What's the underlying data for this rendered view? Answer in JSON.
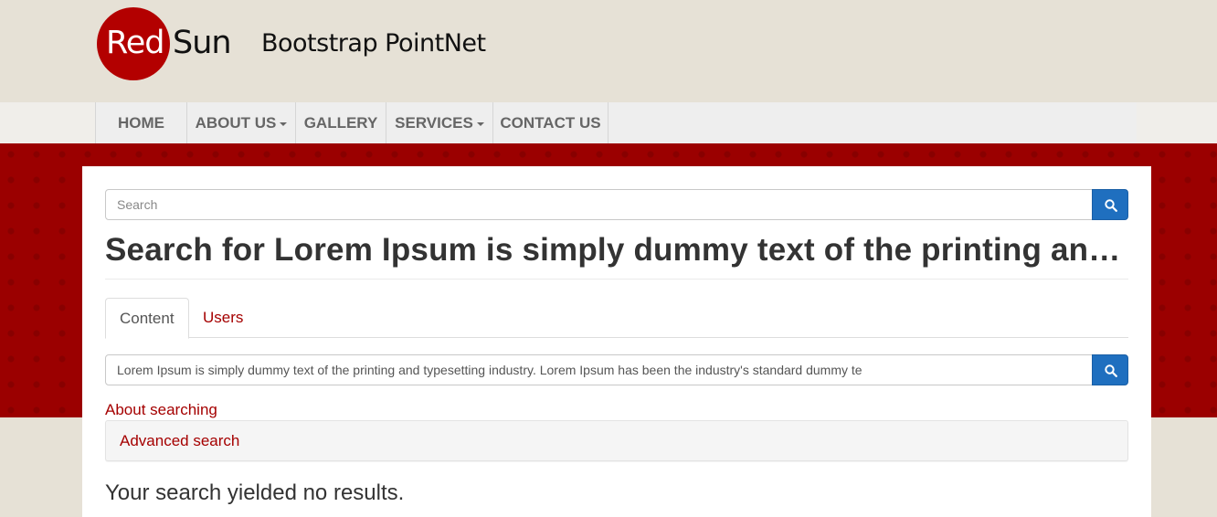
{
  "brand": {
    "logo_red": "Red",
    "logo_sun": "Sun",
    "site_name": "Bootstrap PointNet"
  },
  "nav": {
    "home": "HOME",
    "about": "ABOUT US",
    "gallery": "GALLERY",
    "services": "SERVICES",
    "contact": "CONTACT US"
  },
  "search": {
    "placeholder": "Search",
    "value": ""
  },
  "page": {
    "title": "Search for Lorem Ipsum is simply dummy text of the printing and typesetting industry. Lorem Ipsum has been the industry's standard dummy te"
  },
  "tabs": {
    "content": "Content",
    "users": "Users"
  },
  "query": {
    "value": "Lorem Ipsum is simply dummy text of the printing and typesetting industry. Lorem Ipsum has been the industry's standard dummy te"
  },
  "links": {
    "about_searching": "About searching",
    "advanced_search": "Advanced search"
  },
  "results": {
    "message": "Your search yielded no results."
  },
  "colors": {
    "brand_red": "#b30000",
    "banner_red": "#9b0000",
    "link_red": "#a50000",
    "button_blue": "#1f6fbf"
  },
  "icons": {
    "search_button": "search-icon",
    "dropdown": "caret-down-icon"
  }
}
